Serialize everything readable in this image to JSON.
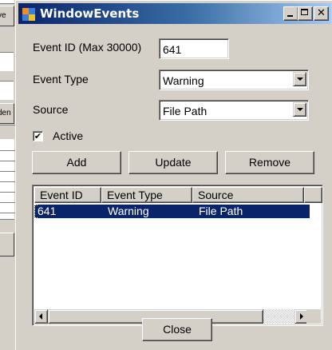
{
  "background_window": {
    "fragments": [
      "ve",
      "den"
    ]
  },
  "window": {
    "title": "WindowEvents",
    "close_glyph": "✕",
    "colors": {
      "title_start": "#0a246a",
      "title_end": "#a6caf0",
      "selection": "#0a246a",
      "face": "#d4d0c8"
    }
  },
  "form": {
    "event_id_label": "Event ID (Max 30000)",
    "event_id_value": "641",
    "event_type_label": "Event Type",
    "event_type_value": "Warning",
    "source_label": "Source",
    "source_value": "File Path",
    "active_label": "Active",
    "active_checked_glyph": "✔"
  },
  "buttons": {
    "add": "Add",
    "update": "Update",
    "remove": "Remove",
    "close": "Close"
  },
  "list": {
    "columns": [
      "Event ID",
      "Event Type",
      "Source"
    ],
    "rows": [
      {
        "event_id": "641",
        "event_type": "Warning",
        "source": "File Path",
        "selected": true
      }
    ]
  }
}
